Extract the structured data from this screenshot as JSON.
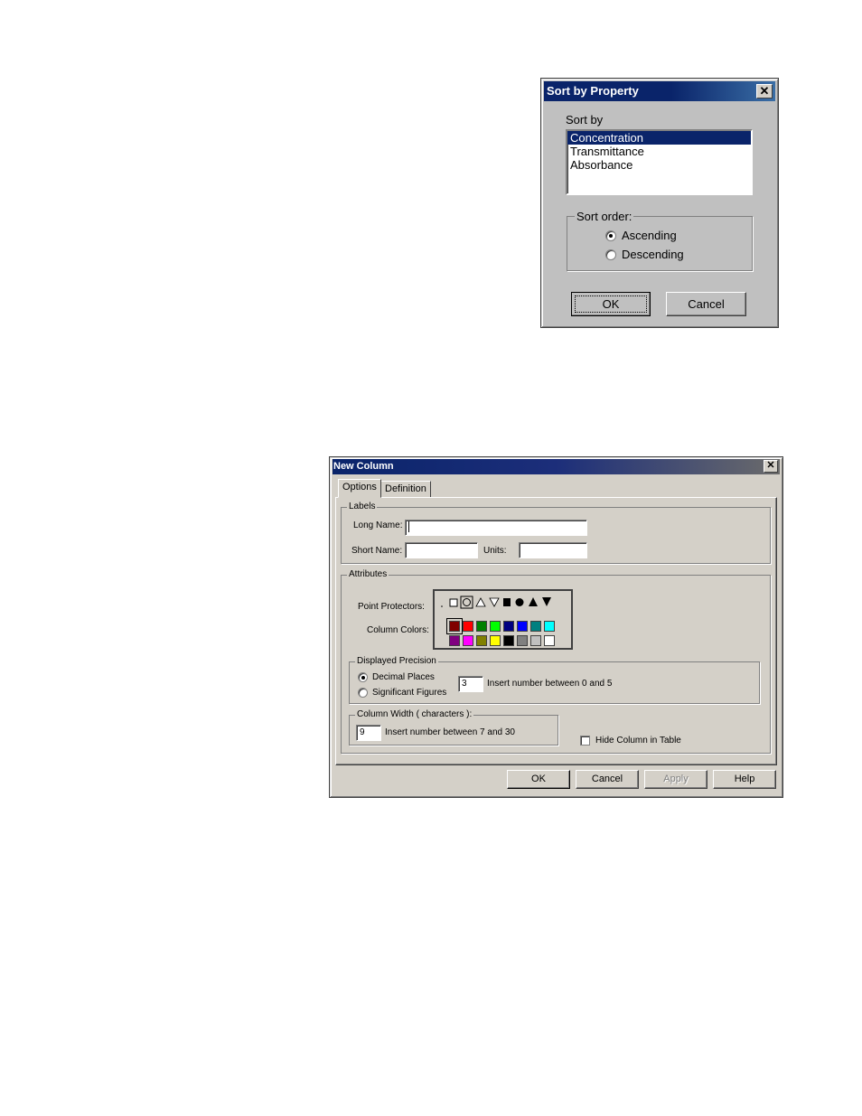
{
  "sort_dialog": {
    "title": "Sort by Property",
    "close_icon": "close-icon",
    "sort_by_label": "Sort by",
    "sort_by_options": [
      "Concentration",
      "Transmittance",
      "Absorbance"
    ],
    "sort_by_selected": "Concentration",
    "sort_order_label": "Sort order:",
    "sort_order_options": [
      {
        "label": "Ascending",
        "checked": true
      },
      {
        "label": "Descending",
        "checked": false
      }
    ],
    "ok_label": "OK",
    "cancel_label": "Cancel"
  },
  "new_column_dialog": {
    "title": "New Column",
    "close_icon": "close-icon",
    "tabs": [
      {
        "label": "Options",
        "active": true
      },
      {
        "label": "Definition",
        "active": false
      }
    ],
    "labels_group": {
      "legend": "Labels",
      "long_name_label": "Long Name:",
      "long_name_value": "",
      "short_name_label": "Short Name:",
      "short_name_value": "",
      "units_label": "Units:",
      "units_value": ""
    },
    "attributes_group": {
      "legend": "Attributes",
      "point_protectors_label": "Point Protectors:",
      "point_protectors": [
        "dot",
        "hollow-square",
        "hollow-circle",
        "hollow-triangle-up",
        "hollow-triangle-down",
        "filled-square",
        "filled-circle",
        "filled-triangle-up",
        "filled-triangle-down"
      ],
      "point_protector_selected": "hollow-circle",
      "column_colors_label": "Column Colors:",
      "column_colors": [
        [
          "#800000",
          "#ff0000",
          "#008000",
          "#00ff00",
          "#000080",
          "#0000ff",
          "#008080",
          "#00ffff"
        ],
        [
          "#800080",
          "#ff00ff",
          "#808000",
          "#ffff00",
          "#000000",
          "#808080",
          "#c0c0c0",
          "#ffffff"
        ]
      ],
      "column_color_selected": "#800000"
    },
    "precision_group": {
      "legend": "Displayed Precision",
      "options": [
        {
          "label": "Decimal Places",
          "checked": true
        },
        {
          "label": "Significant Figures",
          "checked": false
        }
      ],
      "value": "3",
      "hint": "Insert number between 0 and 5"
    },
    "width_group": {
      "legend": "Column Width ( characters ):",
      "value": "9",
      "hint": "Insert number between 7 and 30"
    },
    "hide_column": {
      "label": "Hide Column in Table",
      "checked": false
    },
    "buttons": {
      "ok": "OK",
      "cancel": "Cancel",
      "apply": "Apply",
      "help": "Help"
    }
  }
}
